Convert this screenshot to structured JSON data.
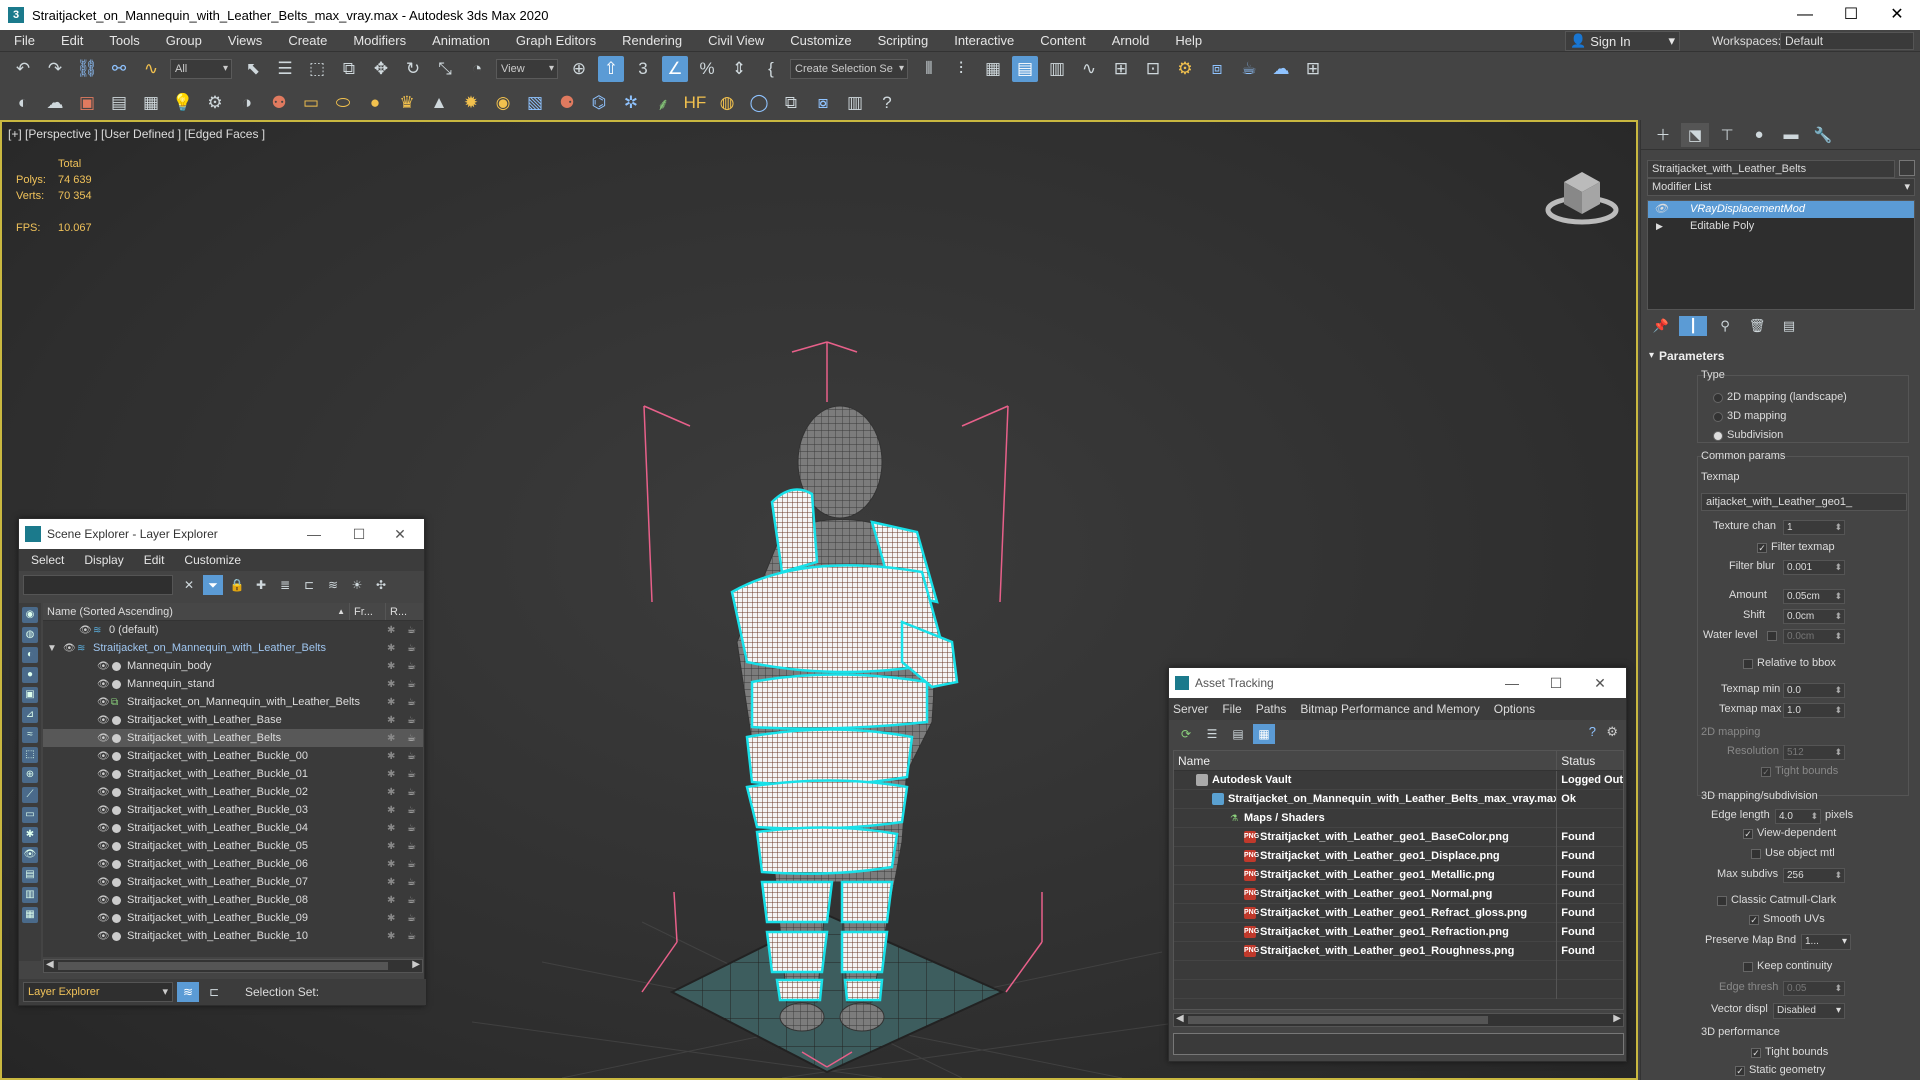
{
  "window": {
    "title": "Straitjacket_on_Mannequin_with_Leather_Belts_max_vray.max - Autodesk 3ds Max 2020",
    "minimize": "—",
    "maximize": "☐",
    "close": "✕"
  },
  "menu": {
    "items": [
      "File",
      "Edit",
      "Tools",
      "Group",
      "Views",
      "Create",
      "Modifiers",
      "Animation",
      "Graph Editors",
      "Rendering",
      "Civil View",
      "Customize",
      "Scripting",
      "Interactive",
      "Content",
      "Arnold",
      "Help"
    ],
    "sign_in": "Sign In",
    "workspaces_label": "Workspaces:",
    "workspaces_value": "Default"
  },
  "toolbar": {
    "selection_filter": "All",
    "reference_coord": "View",
    "named_selection": "Create Selection Se"
  },
  "viewport": {
    "label": "[+] [Perspective ] [User Defined ] [Edged Faces ]",
    "stats": {
      "total_label": "Total",
      "polys_label": "Polys:",
      "polys_value": "74 639",
      "verts_label": "Verts:",
      "verts_value": "70 354",
      "fps_label": "FPS:",
      "fps_value": "10.067"
    }
  },
  "command_panel": {
    "object_name": "Straitjacket_with_Leather_Belts",
    "modifier_list": "Modifier List",
    "stack": [
      {
        "label": "VRayDisplacementMod",
        "selected": true
      },
      {
        "label": "Editable Poly",
        "selected": false
      }
    ],
    "params": {
      "rollout": "Parameters",
      "type_label": "Type",
      "type_options": [
        "2D mapping (landscape)",
        "3D mapping",
        "Subdivision"
      ],
      "type_selected": "Subdivision",
      "common_label": "Common params",
      "texmap_label": "Texmap",
      "texmap_value": "aitjacket_with_Leather_geo1_",
      "texture_chan_label": "Texture chan",
      "texture_chan_value": "1",
      "filter_texmap_label": "Filter texmap",
      "filter_blur_label": "Filter blur",
      "filter_blur_value": "0.001",
      "amount_label": "Amount",
      "amount_value": "0.05cm",
      "shift_label": "Shift",
      "shift_value": "0.0cm",
      "water_level_label": "Water level",
      "water_level_value": "0.0cm",
      "relative_bbox_label": "Relative to bbox",
      "texmap_min_label": "Texmap min",
      "texmap_min_value": "0.0",
      "texmap_max_label": "Texmap max",
      "texmap_max_value": "1.0",
      "mapping2d_label": "2D mapping",
      "resolution_label": "Resolution",
      "resolution_value": "512",
      "tight_bounds_2d_label": "Tight bounds",
      "mapping3d_label": "3D mapping/subdivision",
      "edge_length_label": "Edge length",
      "edge_length_value": "4.0",
      "pixels_label": "pixels",
      "view_dependent_label": "View-dependent",
      "use_object_mtl_label": "Use object mtl",
      "max_subdivs_label": "Max subdivs",
      "max_subdivs_value": "256",
      "classic_cc_label": "Classic Catmull-Clark",
      "smooth_uvs_label": "Smooth UVs",
      "preserve_map_label": "Preserve Map Bnd",
      "preserve_map_value": "1...",
      "keep_continuity_label": "Keep continuity",
      "edge_thresh_label": "Edge thresh",
      "edge_thresh_value": "0.05",
      "vector_displ_label": "Vector displ",
      "vector_displ_value": "Disabled",
      "perf_label": "3D performance",
      "tight_bounds_label": "Tight bounds",
      "static_geometry_label": "Static geometry"
    }
  },
  "scene_explorer": {
    "title": "Scene Explorer - Layer Explorer",
    "menu": [
      "Select",
      "Display",
      "Edit",
      "Customize"
    ],
    "columns": {
      "name": "Name (Sorted Ascending)",
      "frozen": "Fr...",
      "render": "R..."
    },
    "rows": [
      {
        "label": "0 (default)",
        "level": 1,
        "kind": "layer"
      },
      {
        "label": "Straitjacket_on_Mannequin_with_Leather_Belts",
        "level": 0,
        "kind": "layer-selected"
      },
      {
        "label": "Mannequin_body",
        "level": 2,
        "kind": "object"
      },
      {
        "label": "Mannequin_stand",
        "level": 2,
        "kind": "object"
      },
      {
        "label": "Straitjacket_on_Mannequin_with_Leather_Belts",
        "level": 2,
        "kind": "group"
      },
      {
        "label": "Straitjacket_with_Leather_Base",
        "level": 2,
        "kind": "object"
      },
      {
        "label": "Straitjacket_with_Leather_Belts",
        "level": 2,
        "kind": "selected"
      },
      {
        "label": "Straitjacket_with_Leather_Buckle_00",
        "level": 2,
        "kind": "object"
      },
      {
        "label": "Straitjacket_with_Leather_Buckle_01",
        "level": 2,
        "kind": "object"
      },
      {
        "label": "Straitjacket_with_Leather_Buckle_02",
        "level": 2,
        "kind": "object"
      },
      {
        "label": "Straitjacket_with_Leather_Buckle_03",
        "level": 2,
        "kind": "object"
      },
      {
        "label": "Straitjacket_with_Leather_Buckle_04",
        "level": 2,
        "kind": "object"
      },
      {
        "label": "Straitjacket_with_Leather_Buckle_05",
        "level": 2,
        "kind": "object"
      },
      {
        "label": "Straitjacket_with_Leather_Buckle_06",
        "level": 2,
        "kind": "object"
      },
      {
        "label": "Straitjacket_with_Leather_Buckle_07",
        "level": 2,
        "kind": "object"
      },
      {
        "label": "Straitjacket_with_Leather_Buckle_08",
        "level": 2,
        "kind": "object"
      },
      {
        "label": "Straitjacket_with_Leather_Buckle_09",
        "level": 2,
        "kind": "object"
      },
      {
        "label": "Straitjacket_with_Leather_Buckle_10",
        "level": 2,
        "kind": "object"
      }
    ],
    "footer_mode": "Layer Explorer",
    "selection_set_label": "Selection Set:"
  },
  "asset_tracking": {
    "title": "Asset Tracking",
    "menu": [
      "Server",
      "File",
      "Paths",
      "Bitmap Performance and Memory",
      "Options"
    ],
    "columns": {
      "name": "Name",
      "status": "Status"
    },
    "rows": [
      {
        "name": "Autodesk Vault",
        "status": "Logged Out",
        "level": 0,
        "icon": "vault"
      },
      {
        "name": "Straitjacket_on_Mannequin_with_Leather_Belts_max_vray.max",
        "status": "Ok",
        "level": 1,
        "icon": "max"
      },
      {
        "name": "Maps / Shaders",
        "status": "",
        "level": 2,
        "icon": "maps"
      },
      {
        "name": "Straitjacket_with_Leather_geo1_BaseColor.png",
        "status": "Found",
        "level": 3,
        "icon": "png"
      },
      {
        "name": "Straitjacket_with_Leather_geo1_Displace.png",
        "status": "Found",
        "level": 3,
        "icon": "png"
      },
      {
        "name": "Straitjacket_with_Leather_geo1_Metallic.png",
        "status": "Found",
        "level": 3,
        "icon": "png"
      },
      {
        "name": "Straitjacket_with_Leather_geo1_Normal.png",
        "status": "Found",
        "level": 3,
        "icon": "png"
      },
      {
        "name": "Straitjacket_with_Leather_geo1_Refract_gloss.png",
        "status": "Found",
        "level": 3,
        "icon": "png"
      },
      {
        "name": "Straitjacket_with_Leather_geo1_Refraction.png",
        "status": "Found",
        "level": 3,
        "icon": "png"
      },
      {
        "name": "Straitjacket_with_Leather_geo1_Roughness.png",
        "status": "Found",
        "level": 3,
        "icon": "png"
      }
    ]
  },
  "colors": {
    "accent_blue": "#5b9bd5",
    "viewport_border": "#c9b840",
    "stats_text": "#f0c25a",
    "wire_cyan": "#18e0e8",
    "bbox_pink": "#e8608a"
  }
}
